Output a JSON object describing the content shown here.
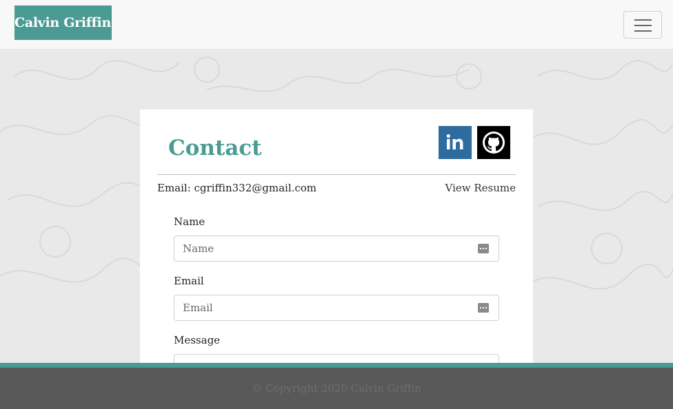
{
  "navbar": {
    "brand": "Calvin Griffin",
    "toggler_icon": "hamburger-icon"
  },
  "contact": {
    "title": "Contact",
    "email_line": "Email: cgriffin332@gmail.com",
    "resume_link": "View Resume",
    "social": [
      {
        "name": "linkedin",
        "icon": "linkedin-icon",
        "color": "#2e6b9e"
      },
      {
        "name": "github",
        "icon": "github-icon",
        "color": "#000000"
      }
    ],
    "form": {
      "name_label": "Name",
      "name_placeholder": "Name",
      "email_label": "Email",
      "email_placeholder": "Email",
      "message_label": "Message"
    }
  },
  "footer": {
    "copyright": "© Copyright 2020 Calvin Griffin"
  },
  "colors": {
    "accent": "#4a9b93",
    "footer": "#595959"
  }
}
